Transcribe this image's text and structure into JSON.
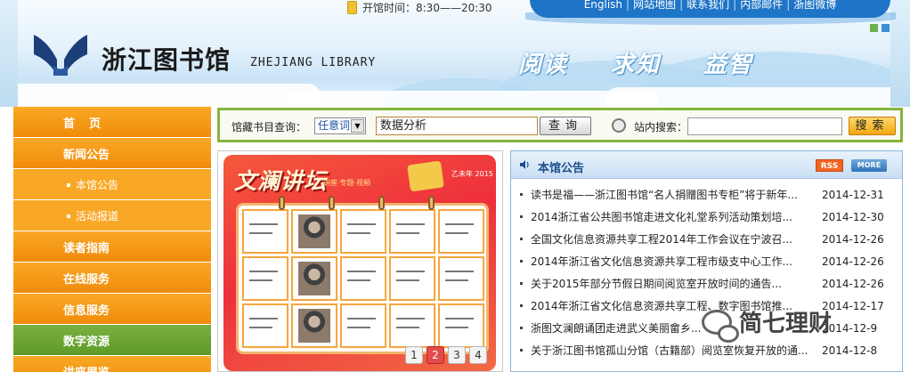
{
  "header": {
    "hours_text": "开馆时间：8:30——20:30",
    "top_links": [
      "English",
      "网站地图",
      "联系我们",
      "内部邮件",
      "浙图微博"
    ],
    "logo_cn": "浙江图书馆",
    "logo_en": "ZHEJIANG LIBRARY",
    "motto": [
      "阅读",
      "求知",
      "益智"
    ],
    "accent_colors": {
      "topbar": "#1e74c6",
      "square_green": "#6ab04c",
      "square_blue": "#3b8fd6"
    }
  },
  "nav": {
    "items": [
      {
        "label": "首页",
        "style": "orange"
      },
      {
        "label": "新闻公告",
        "style": "orange"
      },
      {
        "label": "本馆公告",
        "style": "sub"
      },
      {
        "label": "活动报道",
        "style": "sub"
      },
      {
        "label": "读者指南",
        "style": "orange"
      },
      {
        "label": "在线服务",
        "style": "orange"
      },
      {
        "label": "信息服务",
        "style": "orange"
      },
      {
        "label": "数字资源",
        "style": "green"
      },
      {
        "label": "讲座展览",
        "style": "orange"
      }
    ]
  },
  "search": {
    "catalog_label": "馆藏书目查询：",
    "scope_value": "任意词",
    "query_value": "数据分析",
    "query_button": "查询",
    "site_label": "站内搜索：",
    "site_value": "",
    "site_button": "搜索"
  },
  "feature": {
    "poster_title": "文澜讲坛",
    "poster_sub": "讲座·专题·视频",
    "poster_year": "乙未年 2015",
    "pages": [
      "1",
      "2",
      "3",
      "4"
    ],
    "active_page": "2"
  },
  "news": {
    "title": "本馆公告",
    "rss_label": "RSS",
    "more_label": "MORE",
    "items": [
      {
        "title": "读书是福——浙江图书馆“名人捐赠图书专柜”将于新年...",
        "date": "2014-12-31"
      },
      {
        "title": "2014浙江省公共图书馆走进文化礼堂系列活动策划培...",
        "date": "2014-12-30"
      },
      {
        "title": "全国文化信息资源共享工程2014年工作会议在宁波召...",
        "date": "2014-12-26"
      },
      {
        "title": "2014年浙江省文化信息资源共享工程市级支中心工作...",
        "date": "2014-12-26"
      },
      {
        "title": "关于2015年部分节假日期间阅览室开放时间的通告...",
        "date": "2014-12-26"
      },
      {
        "title": "2014年浙江省文化信息资源共享工程、数字图书馆推...",
        "date": "2014-12-17"
      },
      {
        "title": "浙图文澜朗诵团走进武义美丽畲乡...",
        "date": "2014-12-9"
      },
      {
        "title": "关于浙江图书馆孤山分馆（古籍部）阅览室恢复开放的通...",
        "date": "2014-12-8"
      }
    ]
  },
  "watermark": {
    "text": "简七理财"
  }
}
